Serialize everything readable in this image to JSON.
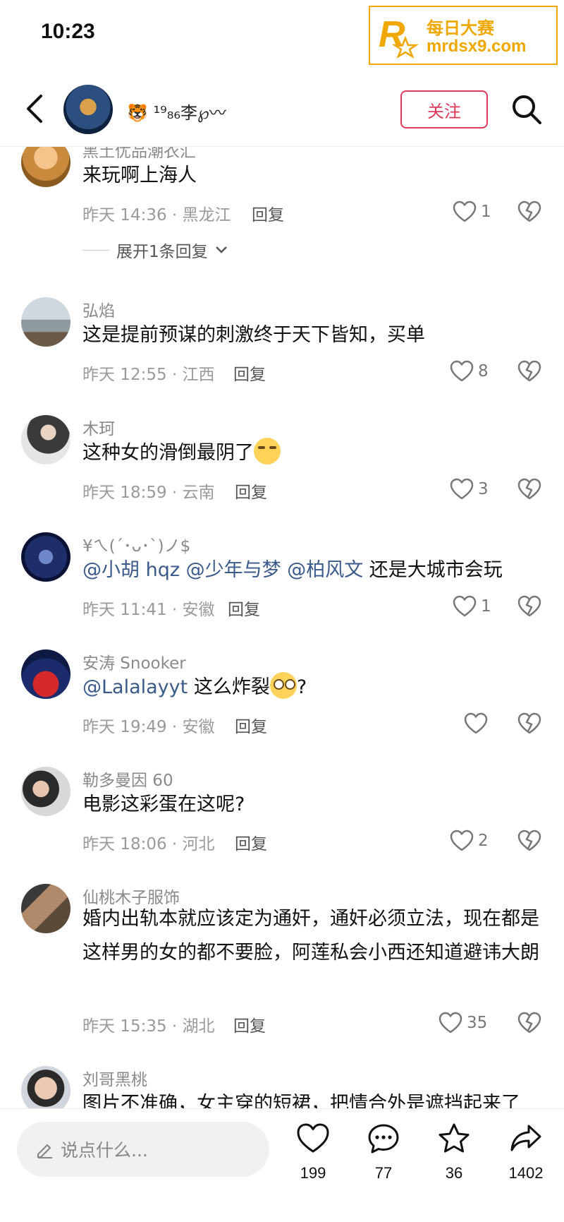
{
  "status_bar": {
    "time": "10:23"
  },
  "watermark": {
    "line1": "每日大赛",
    "line2": "mrdsx9.com"
  },
  "header": {
    "user_name": "🐯 ¹⁹₈₆李℘〰",
    "follow_label": "关注"
  },
  "comments": [
    {
      "user": "黑土优品潮衣汇",
      "text": "来玩啊上海人",
      "time": "昨天 14:36 · 黑龙江",
      "reply_label": "回复",
      "likes": "1",
      "expand_label": "展开1条回复"
    },
    {
      "user": "弘焰",
      "text": "这是提前预谋的刺激终于天下皆知，买单",
      "time": "昨天 12:55 · 江西",
      "reply_label": "回复",
      "likes": "8"
    },
    {
      "user": "木珂",
      "text": "这种女的滑倒最阴了",
      "time": "昨天 18:59 · 云南",
      "reply_label": "回复",
      "likes": "3"
    },
    {
      "user": "¥ㄟ(´･ᴗ･`)ノ$",
      "mentions": [
        "@小胡 hqz",
        "@少年与梦",
        "@柏风文"
      ],
      "text": "还是大城市会玩",
      "time": "昨天 11:41 · 安徽",
      "reply_label": "回复",
      "likes": "1"
    },
    {
      "user": "安涛 Snooker",
      "mentions": [
        "@Lalalayyt"
      ],
      "text": "这么炸裂",
      "text_suffix": "?",
      "time": "昨天 19:49 · 安徽",
      "reply_label": "回复",
      "likes": ""
    },
    {
      "user": "勒多曼因 60",
      "text": "电影这彩蛋在这呢?",
      "time": "昨天 18:06 · 河北",
      "reply_label": "回复",
      "likes": "2"
    },
    {
      "user": "仙桃木子服饰",
      "text": "婚内出轨本就应该定为通奸，通奸必须立法，现在都是这样男的女的都不要脸，阿莲私会小西还知道避讳大朗",
      "time": "昨天 15:35 · 湖北",
      "reply_label": "回复",
      "likes": "35"
    },
    {
      "user": "刘哥黑桃",
      "text": "图片不准确，女主穿的短裙，把情合外是遮挡起来了"
    }
  ],
  "bottom_bar": {
    "input_placeholder": "说点什么...",
    "like_count": "199",
    "comment_count": "77",
    "favorite_count": "36",
    "share_count": "1402"
  },
  "colors": {
    "accent": "#e0395a",
    "mention": "#3a5a8c",
    "watermark": "#f0a800"
  }
}
